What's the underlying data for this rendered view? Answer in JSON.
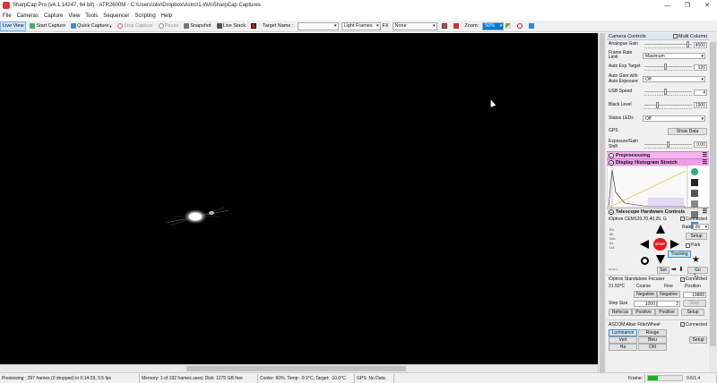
{
  "window": {
    "title": "SharpCap Pro (v4.1.14247, 64 bit) - ATR2600M - C:\\Users\\oliv\\Dropbox\\Astro\\1-WA\\SharpCap Captures"
  },
  "menu": [
    "File",
    "Cameras",
    "Capture",
    "View",
    "Tools",
    "Sequencer",
    "Scripting",
    "Help"
  ],
  "toolbar": {
    "live_view": "Live View",
    "start_capture": "Start Capture",
    "quick_capture": "Quick Capture",
    "stop_capture": "Stop Capture",
    "pause": "Pause",
    "snapshot": "Snapshot",
    "live_stack": "Live Stack",
    "target_label": "Target Name :",
    "target_value": "",
    "frame_type": "Light Frames",
    "fx_label": "FX",
    "fx_value": "None",
    "zoom_label": "Zoom:",
    "zoom_value": "50%"
  },
  "panel": {
    "camera_controls": "Camera Controls",
    "multi_column": "Multi Column",
    "analogue_gain_label": "Analogue Gain",
    "analogue_gain_value": "4500",
    "analogue_gain_level": 0.9,
    "frame_rate_label": "Frame Rate Limit",
    "frame_rate_value": "Maximum",
    "auto_exp_target_label": "Auto Exp Target",
    "auto_exp_target_value": "120",
    "auto_exp_target_level": 0.45,
    "auto_gain_label": "Auto Gain with Auto Exposure",
    "auto_gain_value": "Off",
    "usb_speed_label": "USB Speed",
    "usb_speed_value": "4",
    "usb_speed_level": 0.45,
    "black_level_label": "Black Level",
    "black_level_value": "1900",
    "black_level_level": 0.3,
    "status_leds_label": "Status LEDs",
    "status_leds_value": "Off",
    "gps_label": "GPS",
    "show_data": "Show Data",
    "exp_gain_shift_label": "Exposure/Gain Shift",
    "exp_gain_shift_value": "0.00",
    "exp_gain_shift_level": 0.5,
    "preprocessing": "Preprocessing",
    "histogram": "Display Histogram Stretch",
    "telescope": "Telescope Hardware Controls",
    "mount_name": "iOptron CEM120,70,40,26, G",
    "connected": "Connected",
    "rate_label": "Rate:",
    "rate_value": "8x",
    "setup": "Setup",
    "park": "Park",
    "tracking": "Tracking",
    "stop": "STOP",
    "set": "Set",
    "goto": "Go To...",
    "coords": [
      "RA:",
      "Alt:",
      "Dec:",
      "Az:",
      "Lst:"
    ],
    "focuser_name": "iOptron Standalone Focuser",
    "temp": "21.50°C",
    "coarse": "Coarse",
    "fine": "Fine",
    "position": "Position",
    "negative": "Negative",
    "position_value": "19888",
    "step_size_label": "Step Size",
    "step_coarse": "1000",
    "step_fine": "2",
    "stop_btn": "Stop",
    "refocus": "Refocus",
    "positive": "Positive",
    "filter_wheel": "ASCOM Altair FilterWheel",
    "filters": [
      "Luminance",
      "Rouge",
      "Vert",
      "Bleu",
      "Ha",
      "OIII"
    ],
    "selected_filter": "Luminance"
  },
  "status": {
    "previewing": "Previewing : 297 frames (0 dropped) in 0:14:29, 0.5 fps",
    "memory": "Memory: 1 of 192 frames used, Disk: 1275 GB free",
    "cooler": "Cooler: 60%, Temp: -9.9°C, Target: -10.0°C",
    "gps": "GPS: No Data",
    "frame_label": "Frame:",
    "frame_value": "0.6/1.4"
  },
  "colors": {
    "accent": "#0078d7",
    "preprocessing_bar": "#f2b3ee",
    "stop_red": "#e02020",
    "frame_progress": "#14b814"
  }
}
